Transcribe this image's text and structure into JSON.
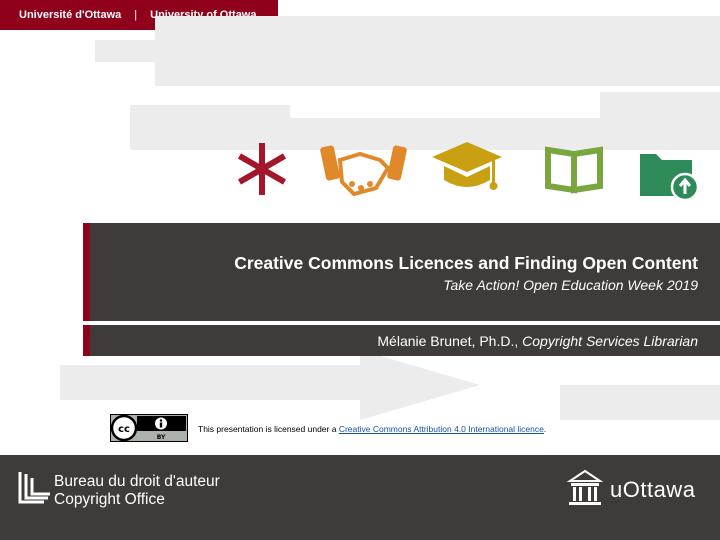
{
  "header": {
    "university_fr": "Université d'Ottawa",
    "separator": "|",
    "university_en": "University of Ottawa"
  },
  "icons": [
    "asterisk-icon",
    "handshake-icon",
    "graduation-cap-icon",
    "open-book-icon",
    "folder-upload-icon"
  ],
  "colors": {
    "brand": "#8f001a",
    "band": "#3f3b39",
    "asterisk": "#a3162b",
    "handshake": "#e0892b",
    "cap": "#c8a012",
    "book": "#7aa640",
    "folder": "#2e8a58"
  },
  "slide": {
    "title": "Creative Commons Licences and Finding Open Content",
    "subtitle": "Take Action! Open Education Week 2019",
    "author_name": "Mélanie Brunet, Ph.D., ",
    "author_role": "Copyright Services Librarian"
  },
  "license": {
    "badge_text": "BY",
    "text_before": "This presentation is licensed under a ",
    "link_text": "Creative Commons Attribution 4.0 International licence",
    "text_after": "."
  },
  "footer": {
    "office_fr": "Bureau du droit d'auteur",
    "office_en": "Copyright Office",
    "uottawa": "uOttawa"
  }
}
